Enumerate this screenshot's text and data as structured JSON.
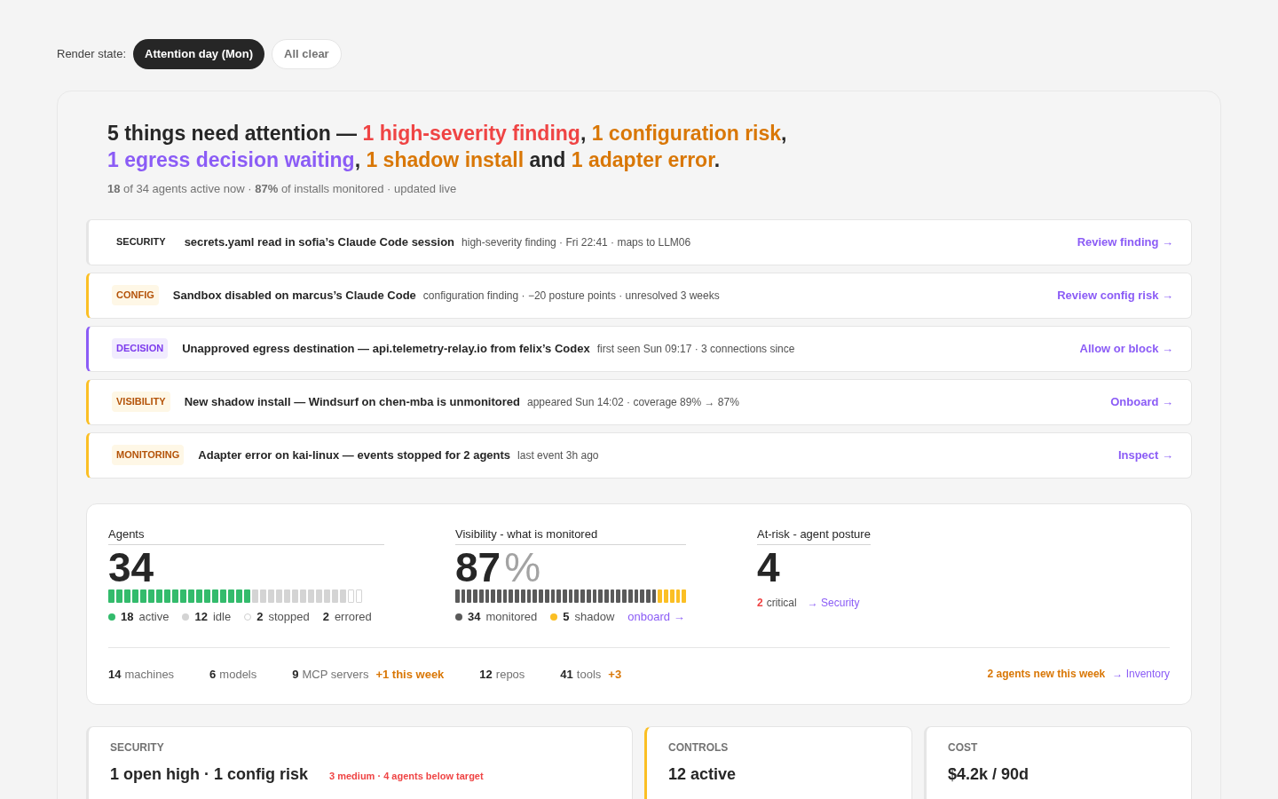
{
  "render_state": {
    "label": "Render state:",
    "options": [
      {
        "label": "Attention day (Mon)",
        "selected": true
      },
      {
        "label": "All clear",
        "selected": false
      }
    ]
  },
  "headline": {
    "parts": [
      {
        "text": "5 things need attention — ",
        "kind": "plain"
      },
      {
        "text": "1 high-severity finding",
        "kind": "high"
      },
      {
        "text": ", ",
        "kind": "plain"
      },
      {
        "text": "1 configuration risk",
        "kind": "warning"
      },
      {
        "text": ", ",
        "kind": "plain"
      },
      {
        "text": "1 egress decision waiting",
        "kind": "decision"
      },
      {
        "text": ", ",
        "kind": "plain"
      },
      {
        "text": "1 shadow install",
        "kind": "warning"
      },
      {
        "text": " and ",
        "kind": "plain"
      },
      {
        "text": "1 adapter error",
        "kind": "warning"
      },
      {
        "text": ".",
        "kind": "plain"
      }
    ],
    "summary": "**18** of 34 agents active now · **87%** of installs monitored · updated live"
  },
  "alerts": [
    {
      "kind": "neutral",
      "tag": "SECURITY",
      "title": "secrets.yaml read in sofia’s Claude Code session",
      "detail": "high-severity finding · Fri 22:41 · maps to LLM06",
      "action": "Review finding →"
    },
    {
      "kind": "warning",
      "tag": "CONFIG",
      "title": "Sandbox disabled on marcus’s Claude Code",
      "detail": "configuration finding · −20 posture points · unresolved 3 weeks",
      "action": "Review config risk →"
    },
    {
      "kind": "decision",
      "tag": "DECISION",
      "title": "Unapproved egress destination — api.telemetry-relay.io from felix’s Codex",
      "detail": "first seen Sun 09:17 · 3 connections since",
      "action": "Allow or block →"
    },
    {
      "kind": "warning",
      "tag": "VISIBILITY",
      "title": "New shadow install — Windsurf on chen-mba is unmonitored",
      "detail": "appeared Sun 14:02 · coverage 89% → 87%",
      "action": "Onboard →"
    },
    {
      "kind": "warning",
      "tag": "MONITORING",
      "title": "Adapter error on kai-linux — events stopped for 2 agents",
      "detail": "last event 3h ago",
      "action": "Inspect →"
    }
  ],
  "agents": {
    "label": "Agents",
    "value": "34",
    "groups": [
      {
        "kind": "active",
        "count": "18",
        "label": "active"
      },
      {
        "kind": "idle",
        "count": "12",
        "label": "idle"
      },
      {
        "kind": "stopped",
        "count": "2",
        "label": "stopped"
      },
      {
        "kind": "errored",
        "count": "2",
        "label": "errored"
      }
    ]
  },
  "visibility": {
    "label": "Visibility - what is monitored",
    "value": "87",
    "unit": "%",
    "groups": [
      {
        "kind": "monitored",
        "count": "34",
        "label": "monitored"
      },
      {
        "kind": "shadow",
        "count": "5",
        "label": "shadow"
      }
    ],
    "link": "onboard →"
  },
  "at_risk": {
    "label": "At-risk - agent posture",
    "value": "4",
    "critical_count": "2",
    "critical_label": "critical",
    "link": "→ Security"
  },
  "inventory": {
    "items": [
      {
        "value": "14",
        "label": "machines"
      },
      {
        "value": "6",
        "label": "models"
      },
      {
        "value": "9",
        "label": "MCP servers",
        "delta": "+1 this week"
      },
      {
        "value": "12",
        "label": "repos"
      },
      {
        "value": "41",
        "label": "tools",
        "delta": "+3"
      }
    ],
    "new_agents": "2 agents new this week",
    "link": "→ Inventory"
  },
  "cards": [
    {
      "kind": "neutral",
      "title": "SECURITY",
      "value": "1 open high · 1 config risk",
      "note": "3 medium · 4 agents below target"
    },
    {
      "kind": "warning",
      "title": "CONTROLS",
      "value": "12 active"
    },
    {
      "kind": "neutral",
      "title": "COST",
      "value": "$4.2k / 90d"
    }
  ]
}
